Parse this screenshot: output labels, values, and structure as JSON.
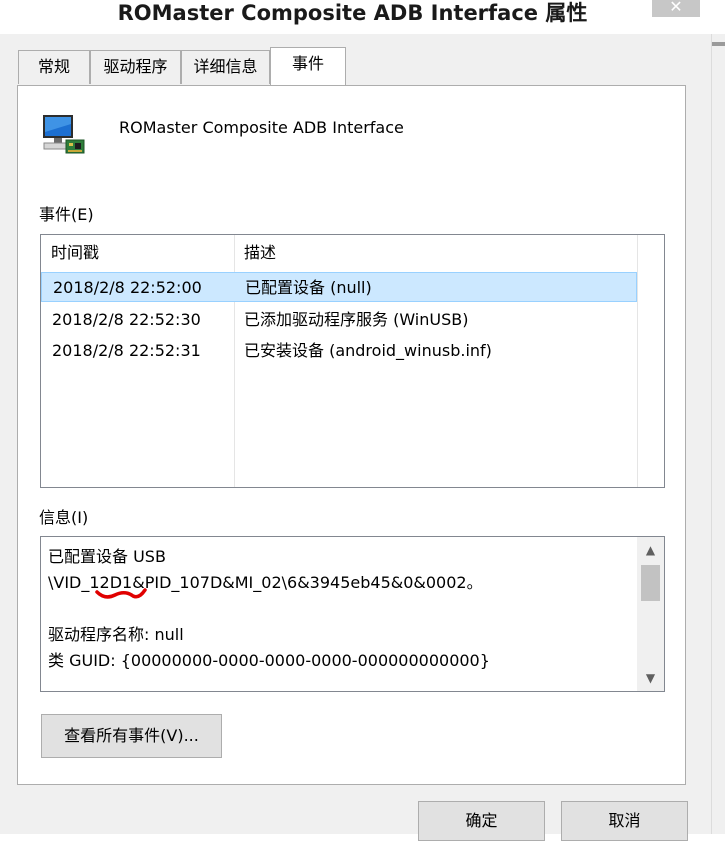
{
  "window": {
    "title": "ROMaster Composite ADB Interface 属性",
    "close_glyph": "✕"
  },
  "tabs": [
    {
      "label": "常规"
    },
    {
      "label": "驱动程序"
    },
    {
      "label": "详细信息"
    },
    {
      "label": "事件",
      "active": true
    }
  ],
  "device": {
    "icon": "usb-device-icon",
    "name": "ROMaster Composite ADB Interface"
  },
  "events": {
    "label": "事件(E)",
    "columns": [
      "时间戳",
      "描述"
    ],
    "rows": [
      {
        "time": "2018/2/8 22:52:00",
        "desc": "已配置设备 (null)",
        "selected": true
      },
      {
        "time": "2018/2/8 22:52:30",
        "desc": "已添加驱动程序服务 (WinUSB)"
      },
      {
        "time": "2018/2/8 22:52:31",
        "desc": "已安装设备 (android_winusb.inf)"
      }
    ]
  },
  "info": {
    "label": "信息(I)",
    "lines": [
      "已配置设备 USB",
      "\\VID_12D1&PID_107D&MI_02\\6&3945eb45&0&0002。",
      "",
      "驱动程序名称: null",
      "类 GUID: {00000000-0000-0000-0000-000000000000}"
    ],
    "scroll_up_glyph": "▲",
    "scroll_down_glyph": "▼"
  },
  "buttons": {
    "view_all": "查看所有事件(V)...",
    "ok": "确定",
    "cancel": "取消"
  },
  "colors": {
    "selection_bg": "#cce8ff",
    "selection_border": "#99d1ff",
    "annotation_red": "#e00000"
  }
}
